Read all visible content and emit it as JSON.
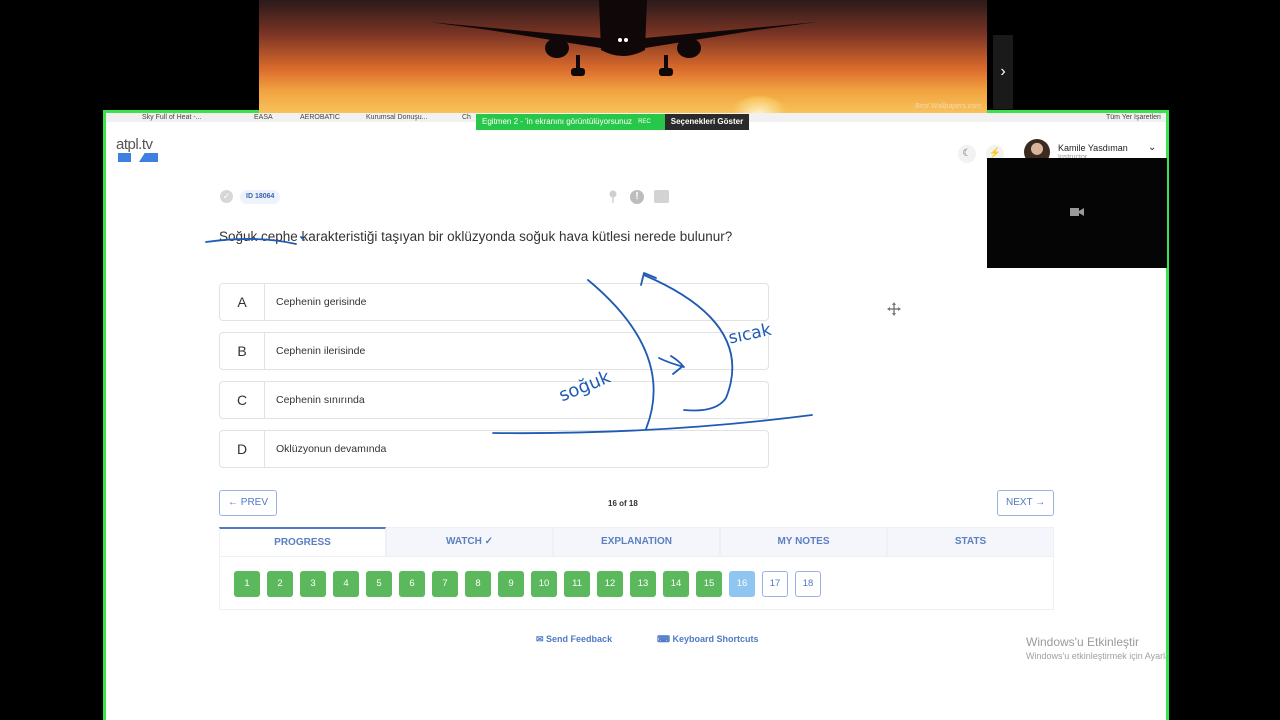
{
  "bookmarks": [
    "Sky Full of Heat -...",
    "EASA",
    "AEROBATIC",
    "Kurumsal Donuşu...",
    "Ch",
    "Tüm Yer İşaretleri"
  ],
  "share_banner": {
    "message": "Egitmen 2 - 'in ekranını görüntülüyorsunuz",
    "rec": "REC",
    "options_label": "Seçenekleri Göster"
  },
  "app": {
    "logo_text": "atpl.tv"
  },
  "user": {
    "name": "Kamile Yasdıman",
    "role": "Instructor"
  },
  "question": {
    "id_label": "ID 18064",
    "text": "Soğuk cephe karakteristiği taşıyan bir oklüzyonda soğuk hava kütlesi nerede bulunur?",
    "options": [
      {
        "letter": "A",
        "text": "Cephenin gerisinde"
      },
      {
        "letter": "B",
        "text": "Cephenin ilerisinde"
      },
      {
        "letter": "C",
        "text": "Cephenin sınırında"
      },
      {
        "letter": "D",
        "text": "Oklüzyonun devamında"
      }
    ]
  },
  "nav": {
    "prev": "PREV",
    "next": "NEXT",
    "counter": "16 of 18"
  },
  "tabs": [
    "PROGRESS",
    "WATCH",
    "EXPLANATION",
    "MY NOTES",
    "STATS"
  ],
  "progress": {
    "numbers": [
      "1",
      "2",
      "3",
      "4",
      "5",
      "6",
      "7",
      "8",
      "9",
      "10",
      "11",
      "12",
      "13",
      "14",
      "15",
      "16",
      "17",
      "18"
    ],
    "completed": 15,
    "current": 16
  },
  "footer": {
    "send_feedback": "Send Feedback",
    "keyboard_shortcuts": "Keyboard Shortcuts"
  },
  "windows": {
    "activate_title": "Windows'u Etkinleştir",
    "activate_sub": "Windows'u etkinleştirmek için Ayarlar'a gidin."
  },
  "annotations": {
    "cold_label": "soğuk",
    "warm_label": "sıcak"
  },
  "video": {
    "watermark": "Best Wallpapers.com"
  },
  "colors": {
    "accent": "#4f79c6",
    "done": "#5cb85c",
    "current": "#8ec5f1",
    "share_border": "#3be24a",
    "ink": "#1f5bb5"
  }
}
